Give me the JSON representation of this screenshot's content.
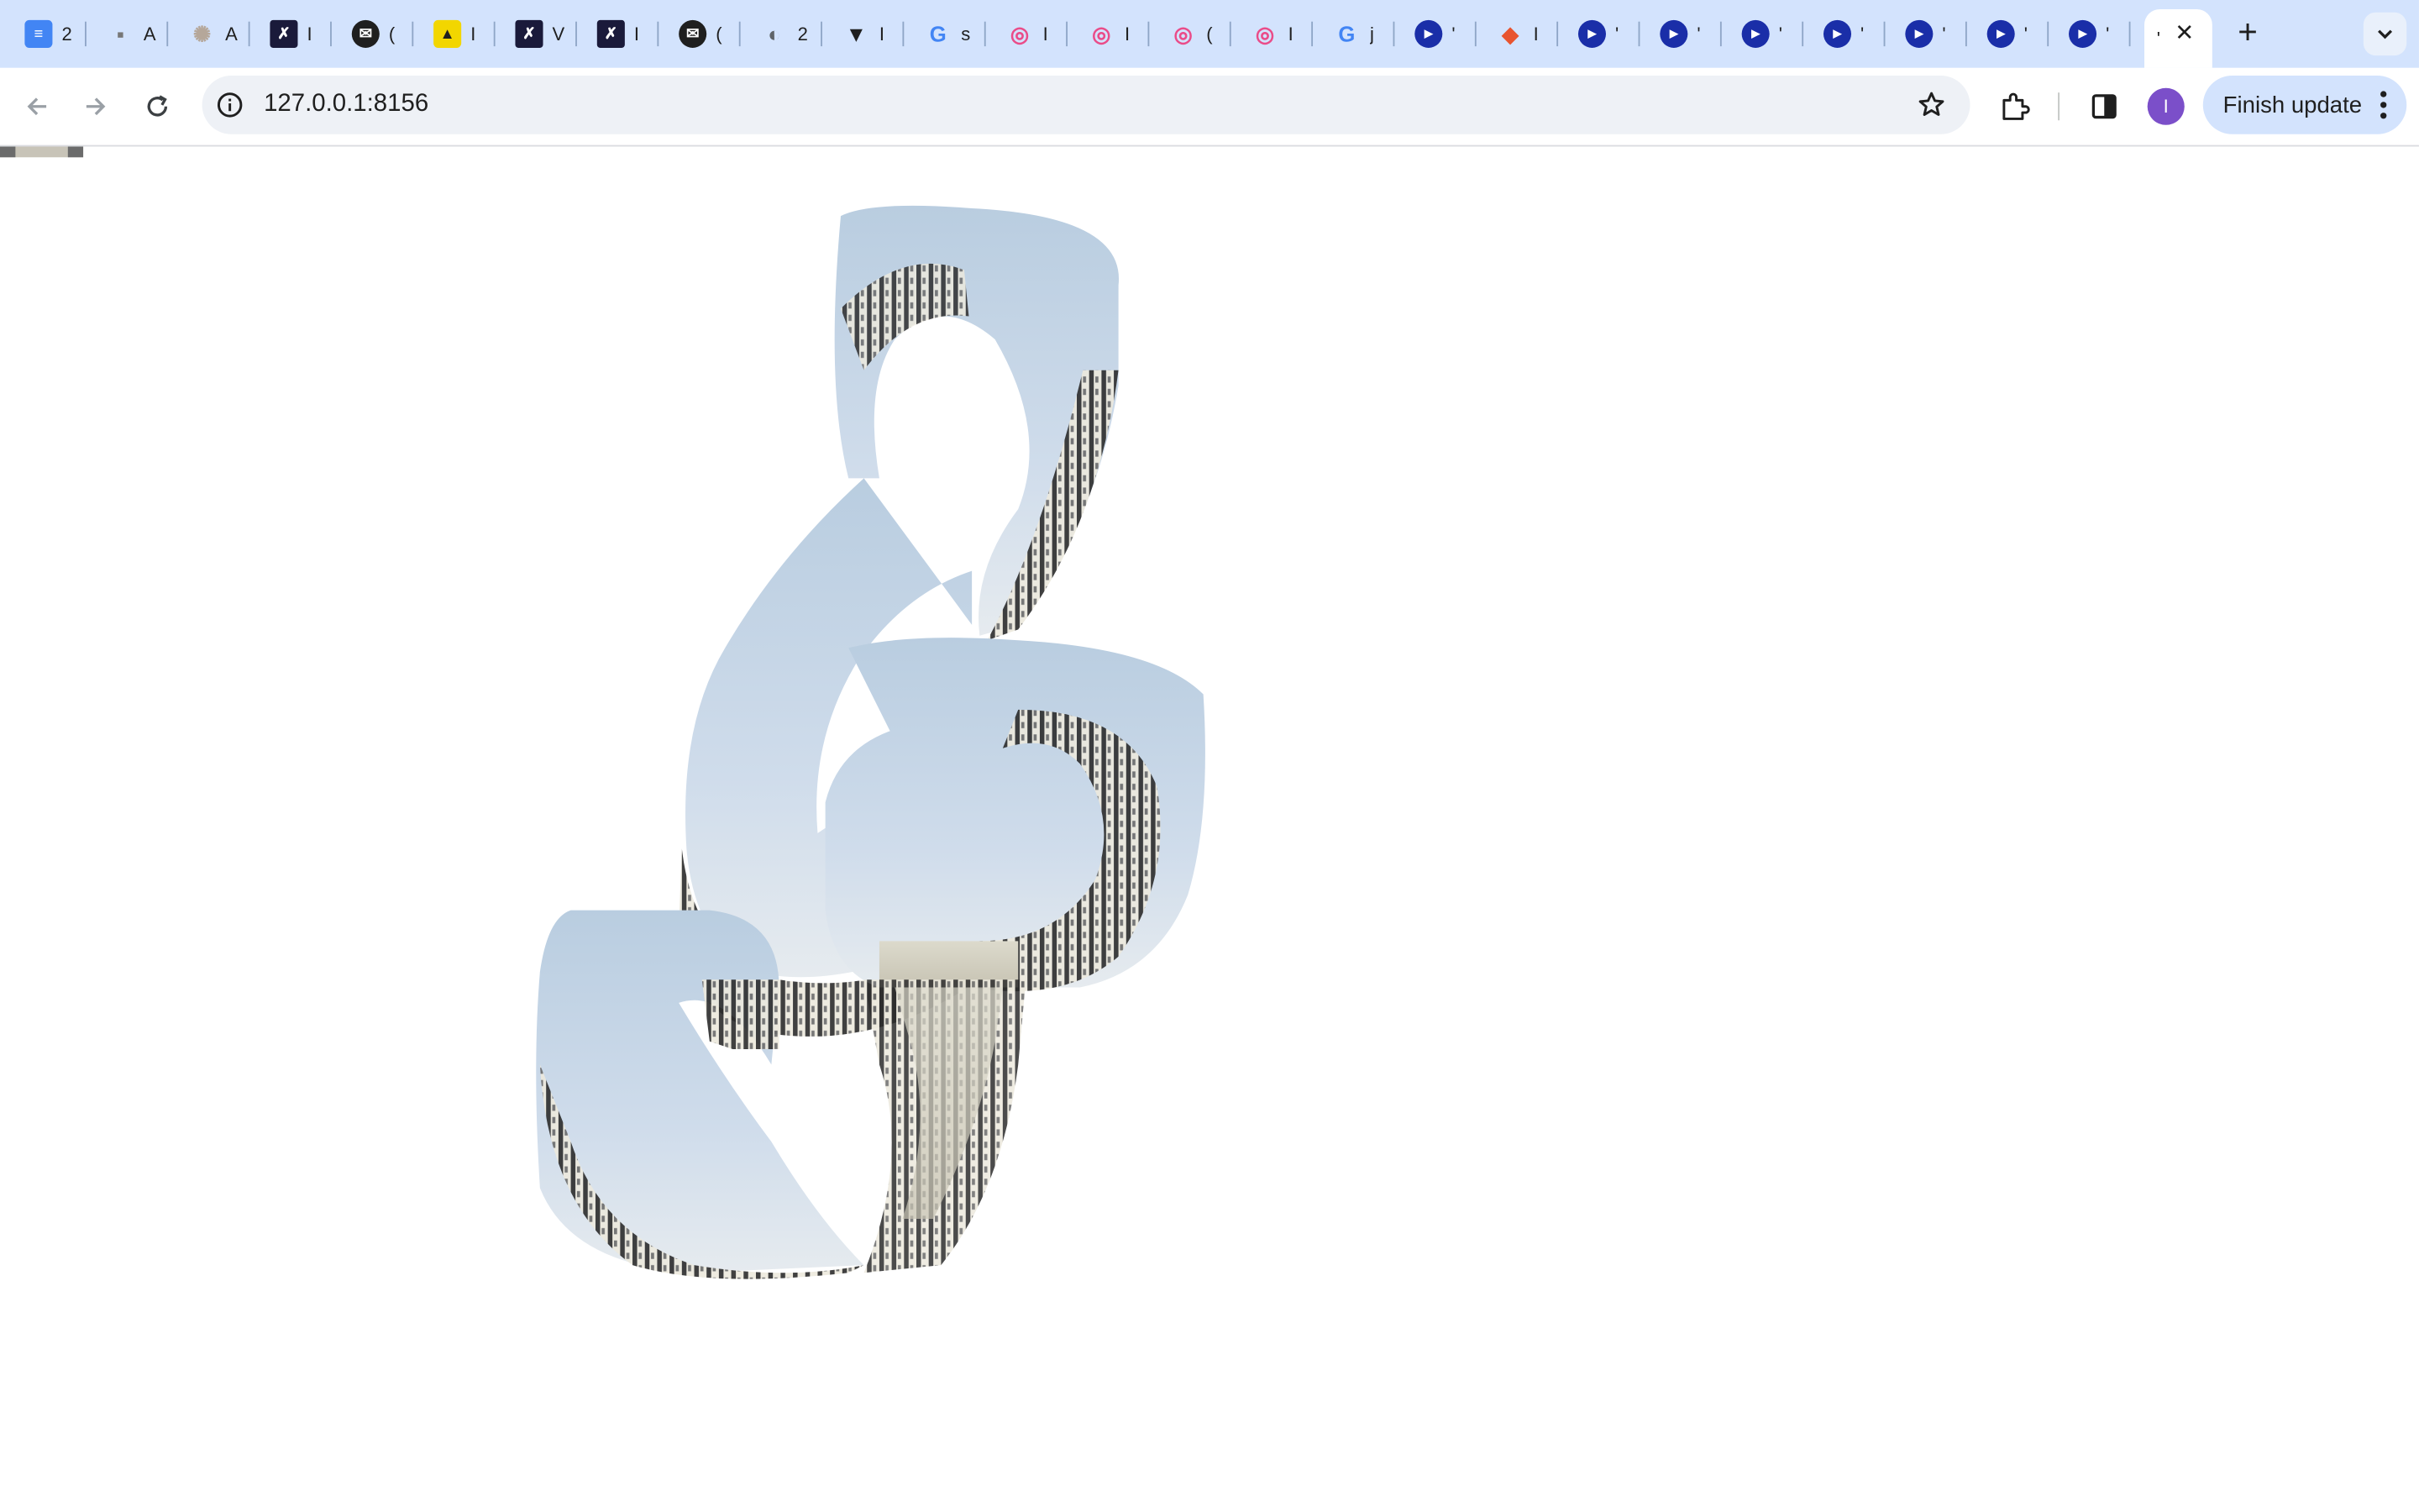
{
  "browser": {
    "tabs": [
      {
        "title": "2",
        "icon": "google-docs-icon",
        "color": "#4285f4"
      },
      {
        "title": "A",
        "icon": "generic-site-icon",
        "color": "#777777"
      },
      {
        "title": "A",
        "icon": "openai-icon",
        "color": "#b5a79a"
      },
      {
        "title": "I",
        "icon": "editor-icon",
        "color": "#1a1a3a"
      },
      {
        "title": "(",
        "icon": "mail-icon",
        "color": "#1f1f1f"
      },
      {
        "title": "I",
        "icon": "yellow-app-icon",
        "color": "#f2d600"
      },
      {
        "title": "V",
        "icon": "editor-icon",
        "color": "#1a1a3a"
      },
      {
        "title": "I",
        "icon": "editor-icon",
        "color": "#1a1a3a"
      },
      {
        "title": "(",
        "icon": "mail-icon",
        "color": "#1f1f1f"
      },
      {
        "title": "2",
        "icon": "globe-icon",
        "color": "#5f6368"
      },
      {
        "title": "I",
        "icon": "vector-icon",
        "color": "#1f1f1f"
      },
      {
        "title": "s",
        "icon": "google-icon",
        "color": "#4285f4"
      },
      {
        "title": "I",
        "icon": "dribbble-icon",
        "color": "#ea4c89"
      },
      {
        "title": "I",
        "icon": "dribbble-icon",
        "color": "#ea4c89"
      },
      {
        "title": "(",
        "icon": "dribbble-icon",
        "color": "#ea4c89"
      },
      {
        "title": "I",
        "icon": "dribbble-icon",
        "color": "#ea4c89"
      },
      {
        "title": "j",
        "icon": "google-icon",
        "color": "#4285f4"
      },
      {
        "title": "'",
        "icon": "play-icon",
        "color": "#1a2ea8"
      },
      {
        "title": "I",
        "icon": "colorful-app-icon",
        "color": "#e8542f"
      },
      {
        "title": "'",
        "icon": "play-icon",
        "color": "#1a2ea8"
      },
      {
        "title": "'",
        "icon": "play-icon",
        "color": "#1a2ea8"
      },
      {
        "title": "'",
        "icon": "play-icon",
        "color": "#1a2ea8"
      },
      {
        "title": "'",
        "icon": "play-icon",
        "color": "#1a2ea8"
      },
      {
        "title": "'",
        "icon": "play-icon",
        "color": "#1a2ea8"
      },
      {
        "title": "'",
        "icon": "play-icon",
        "color": "#1a2ea8"
      },
      {
        "title": "'",
        "icon": "play-icon",
        "color": "#1a2ea8"
      }
    ],
    "active_tab": {
      "title": "'",
      "close_icon": "close-icon"
    },
    "new_tab_icon": "plus-icon",
    "tab_search_icon": "chevron-down-icon",
    "url": "127.0.0.1:8156",
    "profile_initial": "I",
    "finish_update_label": "Finish update",
    "accent": "#d3e3fd"
  },
  "page": {
    "content": "3d-swirl-sculpture-image"
  }
}
